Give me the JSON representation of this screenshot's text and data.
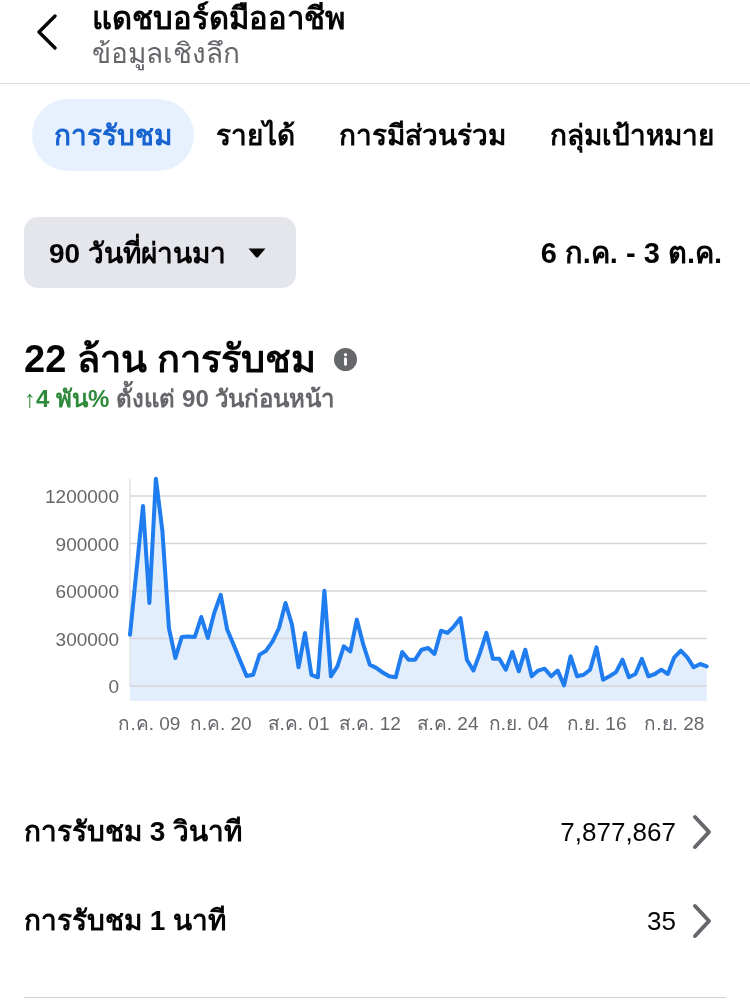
{
  "header": {
    "title": "แดชบอร์ดมืออาชีพ",
    "subtitle": "ข้อมูลเชิงลึก"
  },
  "tabs": [
    {
      "label": "การรับชม",
      "selected": true
    },
    {
      "label": "รายได้",
      "selected": false
    },
    {
      "label": "การมีส่วนร่วม",
      "selected": false
    },
    {
      "label": "กลุ่มเป้าหมาย",
      "selected": false
    }
  ],
  "date_filter": {
    "value": "90 วันที่ผ่านมา",
    "range": "6 ก.ค. - 3 ต.ค."
  },
  "summary": {
    "total": "22 ล้าน การรับชม",
    "change": "↑4 พัน%",
    "change_period": "ตั้งแต่ 90 วันก่อนหน้า",
    "chart_data": {
      "type": "area",
      "grid": true,
      "categories": [
        null,
        null,
        null,
        "ก.ค. 09",
        null,
        null,
        null,
        null,
        null,
        null,
        null,
        null,
        null,
        null,
        "ก.ค. 20",
        null,
        null,
        null,
        null,
        null,
        null,
        null,
        null,
        null,
        null,
        null,
        "ส.ค. 01",
        null,
        null,
        null,
        null,
        null,
        null,
        null,
        null,
        null,
        null,
        "ส.ค. 12",
        null,
        null,
        null,
        null,
        null,
        null,
        null,
        null,
        null,
        null,
        null,
        "ส.ค. 24",
        null,
        null,
        null,
        null,
        null,
        null,
        null,
        null,
        null,
        null,
        "ก.ย. 04",
        null,
        null,
        null,
        null,
        null,
        null,
        null,
        null,
        null,
        null,
        null,
        "ก.ย. 16",
        null,
        null,
        null,
        null,
        null,
        null,
        null,
        null,
        null,
        null,
        null,
        "ก.ย. 28",
        null,
        null,
        null,
        null,
        null
      ],
      "values": [
        324000,
        730000,
        1137000,
        524000,
        1309000,
        979000,
        366000,
        177000,
        310000,
        312000,
        310000,
        436000,
        303000,
        461000,
        575000,
        356000,
        258000,
        160000,
        63000,
        71000,
        198000,
        223000,
        282000,
        366000,
        524000,
        387000,
        118000,
        335000,
        71000,
        55000,
        602000,
        61000,
        124000,
        251000,
        219000,
        419000,
        261000,
        135000,
        114000,
        85000,
        61000,
        55000,
        215000,
        166000,
        166000,
        229000,
        240000,
        202000,
        349000,
        335000,
        377000,
        429000,
        166000,
        97000,
        208000,
        335000,
        172000,
        172000,
        103000,
        215000,
        93000,
        229000,
        61000,
        97000,
        109000,
        61000,
        97000,
        4000,
        188000,
        61000,
        71000,
        103000,
        244000,
        40000,
        61000,
        88000,
        166000,
        55000,
        76000,
        171000,
        61000,
        76000,
        103000,
        76000,
        181000,
        223000,
        181000,
        118000,
        139000,
        124000
      ],
      "ylim": [
        0,
        1309000
      ],
      "yticks": [
        0,
        300000,
        600000,
        900000,
        1200000
      ]
    }
  },
  "metrics": [
    {
      "label": "การรับชม 3 วินาที",
      "value": "7,877,867"
    },
    {
      "label": "การรับชม 1 นาที",
      "value": "35"
    }
  ]
}
